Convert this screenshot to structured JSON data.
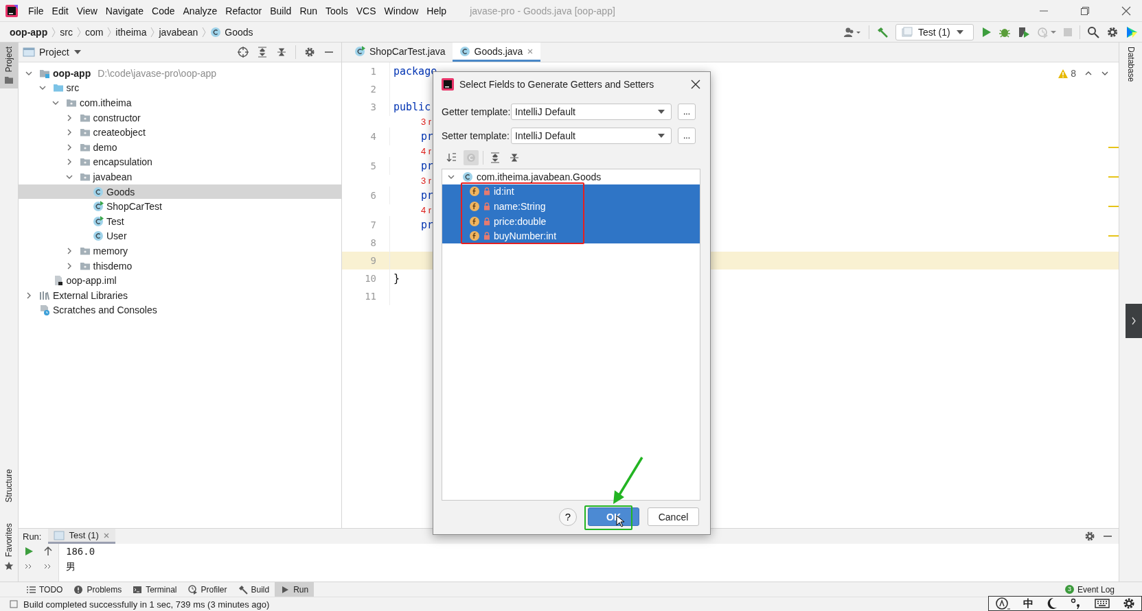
{
  "window": {
    "title": "javase-pro - Goods.java [oop-app]"
  },
  "menu": [
    "File",
    "Edit",
    "View",
    "Navigate",
    "Code",
    "Analyze",
    "Refactor",
    "Build",
    "Run",
    "Tools",
    "VCS",
    "Window",
    "Help"
  ],
  "breadcrumbs": [
    {
      "label": "oop-app",
      "kind": "module"
    },
    {
      "label": "src",
      "kind": "folder"
    },
    {
      "label": "com",
      "kind": "folder"
    },
    {
      "label": "itheima",
      "kind": "folder"
    },
    {
      "label": "javabean",
      "kind": "folder"
    },
    {
      "label": "Goods",
      "kind": "class"
    }
  ],
  "run_config": {
    "label": "Test (1)"
  },
  "left_stripe": [
    {
      "label": "Project",
      "selected": true
    },
    {
      "label": "Structure",
      "selected": false
    },
    {
      "label": "Favorites",
      "selected": false
    }
  ],
  "right_stripe": [
    {
      "label": "Database",
      "selected": false
    }
  ],
  "project_panel": {
    "title": "Project",
    "tree": [
      {
        "label": "oop-app",
        "path": "D:\\code\\javase-pro\\oop-app",
        "kind": "module",
        "expanded": true,
        "selected": false,
        "children": [
          {
            "label": "src",
            "kind": "source-folder",
            "expanded": true,
            "selected": false,
            "children": [
              {
                "label": "com.itheima",
                "kind": "package",
                "expanded": true,
                "selected": false,
                "children": [
                  {
                    "label": "constructor",
                    "kind": "package",
                    "expanded": false,
                    "selected": false
                  },
                  {
                    "label": "createobject",
                    "kind": "package",
                    "expanded": false,
                    "selected": false
                  },
                  {
                    "label": "demo",
                    "kind": "package",
                    "expanded": false,
                    "selected": false
                  },
                  {
                    "label": "encapsulation",
                    "kind": "package",
                    "expanded": false,
                    "selected": false
                  },
                  {
                    "label": "javabean",
                    "kind": "package",
                    "expanded": true,
                    "selected": false,
                    "children": [
                      {
                        "label": "Goods",
                        "kind": "class",
                        "selected": true
                      },
                      {
                        "label": "ShopCarTest",
                        "kind": "runnable-class",
                        "selected": false
                      },
                      {
                        "label": "Test",
                        "kind": "runnable-class",
                        "selected": false
                      },
                      {
                        "label": "User",
                        "kind": "class",
                        "selected": false
                      }
                    ]
                  },
                  {
                    "label": "memory",
                    "kind": "package",
                    "expanded": false,
                    "selected": false
                  },
                  {
                    "label": "thisdemo",
                    "kind": "package",
                    "expanded": false,
                    "selected": false
                  }
                ]
              }
            ]
          },
          {
            "label": "oop-app.iml",
            "kind": "module-file",
            "selected": false
          }
        ]
      },
      {
        "label": "External Libraries",
        "kind": "libraries",
        "expanded": false,
        "selected": false
      },
      {
        "label": "Scratches and Consoles",
        "kind": "scratches",
        "selected": false
      }
    ]
  },
  "editor": {
    "tabs": [
      {
        "label": "ShopCarTest.java",
        "kind": "runnable-class",
        "selected": false
      },
      {
        "label": "Goods.java",
        "kind": "class",
        "selected": true
      }
    ],
    "warnings": "8",
    "lines": [
      {
        "number": "1",
        "code": "package",
        "kind": "keyword",
        "current": false
      },
      {
        "number": "2",
        "current": false
      },
      {
        "number": "3",
        "code": "public",
        "kind": "keyword",
        "current": false
      },
      {
        "number": "4",
        "hint": "3 r",
        "code": "pr",
        "kind": "keyword",
        "current": false
      },
      {
        "number": "5",
        "hint": "4 r",
        "code": "pr",
        "kind": "keyword",
        "current": false
      },
      {
        "number": "6",
        "hint": "3 r",
        "code": "pr",
        "kind": "keyword",
        "current": false
      },
      {
        "number": "7",
        "hint": "4 r",
        "code": "pr",
        "kind": "keyword",
        "current": false
      },
      {
        "number": "8",
        "current": false
      },
      {
        "number": "9",
        "current": true
      },
      {
        "number": "10",
        "code": "}",
        "kind": "plain",
        "current": false
      },
      {
        "number": "11",
        "current": false
      }
    ]
  },
  "dialog": {
    "title": "Select Fields to Generate Getters and Setters",
    "templates": [
      {
        "label": "Getter template:",
        "value": "IntelliJ Default",
        "more": "..."
      },
      {
        "label": "Setter template:",
        "value": "IntelliJ Default",
        "more": "..."
      }
    ],
    "toolbar": [
      {
        "kind": "sort",
        "selected": false
      },
      {
        "kind": "classes",
        "selected": true
      },
      {
        "kind": "expand",
        "selected": false
      },
      {
        "kind": "collapse",
        "selected": false
      }
    ],
    "tree": {
      "label": "com.itheima.javabean.Goods",
      "expanded": true,
      "selected": false,
      "children": [
        {
          "label": "id:int",
          "selected": true
        },
        {
          "label": "name:String",
          "selected": true
        },
        {
          "label": "price:double",
          "selected": true
        },
        {
          "label": "buyNumber:int",
          "selected": true
        }
      ]
    },
    "buttons": [
      {
        "kind": "help",
        "label": "?",
        "default": false
      },
      {
        "kind": "ok",
        "label": "OK",
        "default": true
      },
      {
        "kind": "cancel",
        "label": "Cancel",
        "default": false
      }
    ]
  },
  "run_panel": {
    "label": "Run:",
    "tabs": [
      {
        "label": "Test (1)",
        "selected": true
      }
    ],
    "output": [
      "186.0",
      "男"
    ]
  },
  "tool_tabs": [
    {
      "label": "TODO",
      "kind": "todo",
      "selected": false
    },
    {
      "label": "Problems",
      "kind": "problems",
      "selected": false
    },
    {
      "label": "Terminal",
      "kind": "terminal",
      "selected": false
    },
    {
      "label": "Profiler",
      "kind": "profiler",
      "selected": false
    },
    {
      "label": "Build",
      "kind": "build",
      "selected": false
    },
    {
      "label": "Run",
      "kind": "run",
      "selected": true
    }
  ],
  "event_log": {
    "label": "Event Log",
    "count": "3"
  },
  "status_bar": {
    "message": "Build completed successfully in 1 sec, 739 ms (3 minutes ago)"
  },
  "ime_toolbar": {
    "mode": "中"
  }
}
